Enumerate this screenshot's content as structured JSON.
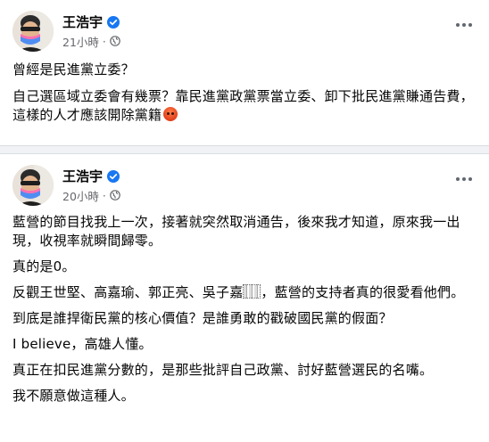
{
  "posts": [
    {
      "author": "王浩宇",
      "time": "21小時",
      "separator": "·",
      "paragraphs": [
        "曾經是民進黨立委？",
        "自己選區域立委會有幾票？靠民進黨政黨票當立委、卸下批民進黨賺通告費，這樣的人才應該開除黨籍"
      ],
      "emoji": "angry-emoji"
    },
    {
      "author": "王浩宇",
      "time": "20小時",
      "separator": "·",
      "paragraphs": [
        "藍營的節目找我上一次，接著就突然取消通告，後來我才知道，原來我一出現，收視率就瞬間歸零。",
        "真的是0。",
        "反觀王世堅、高嘉瑜、郭正亮、吳子嘉",
        "，藍營的支持者真的很愛看他們。",
        "到底是誰捍衛民黨的核心價值？是誰勇敢的戳破國民黨的假面？",
        "I believe，高雄人懂。",
        "真正在扣民進黨分數的，是那些批評自己政黨、討好藍營選民的名嘴。",
        "我不願意做這種人。"
      ]
    }
  ],
  "icons": {
    "verified": "verified-badge-icon",
    "privacy": "globe-icon",
    "more": "more-options-icon"
  },
  "colors": {
    "verified": "#1877f2",
    "meta": "#65676b",
    "background": "#f0f2f5"
  }
}
